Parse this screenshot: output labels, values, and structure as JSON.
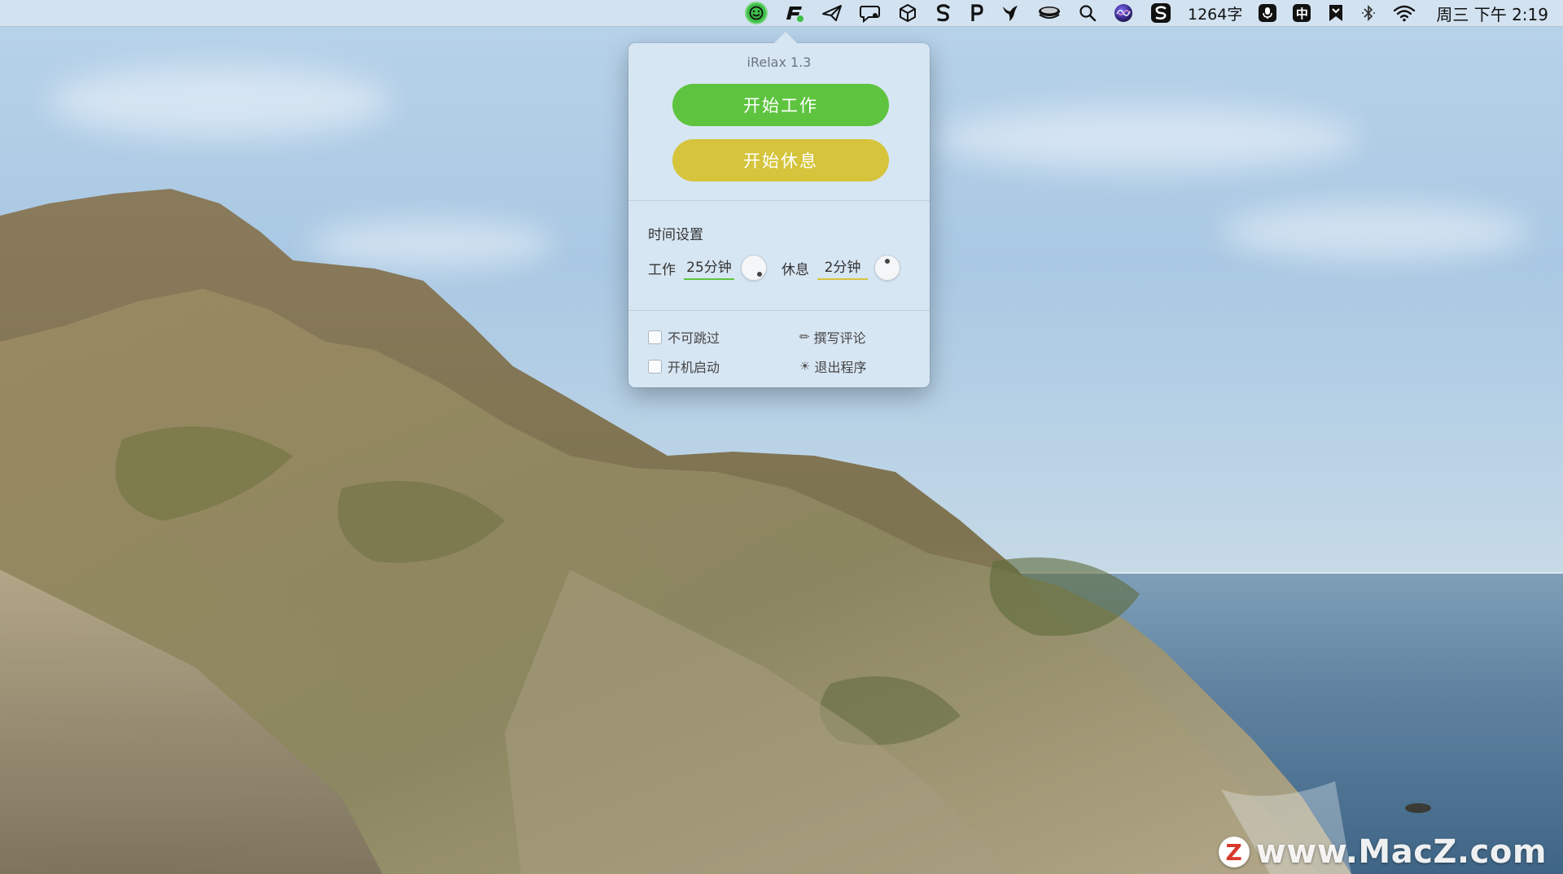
{
  "menubar": {
    "word_count": "1264字",
    "input_method": "中",
    "clock": "周三 下午 2:19"
  },
  "popover": {
    "title": "iRelax 1.3",
    "start_work": "开始工作",
    "start_rest": "开始休息",
    "time_settings_label": "时间设置",
    "work_label": "工作",
    "work_value": "25分钟",
    "rest_label": "休息",
    "rest_value": "2分钟",
    "no_skip_label": "不可跳过",
    "launch_at_login_label": "开机启动",
    "write_review_label": "撰写评论",
    "quit_label": "退出程序",
    "write_review_icon": "pencil-icon",
    "quit_icon": "gear-icon"
  },
  "colors": {
    "work_green": "#5ec43f",
    "rest_yellow": "#d5c43c",
    "popover_bg": "#d7e6f3"
  },
  "watermark": {
    "logo_letter": "Z",
    "text": "www.MacZ.com"
  }
}
